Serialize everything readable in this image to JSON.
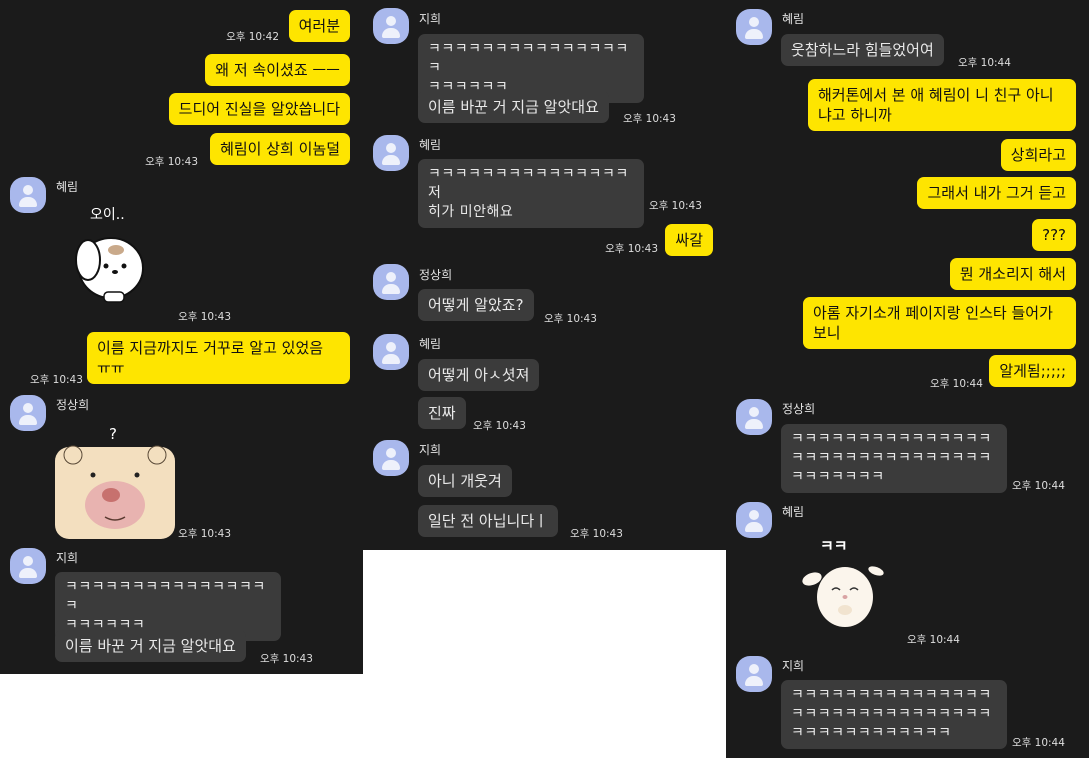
{
  "colors": {
    "background": "#1b1b1b",
    "my_bubble": "#fee500",
    "other_bubble": "#3b3b3b",
    "avatar": "#a9b8ec"
  },
  "icons": {
    "avatar": "default-profile-icon",
    "sticker1": "puppy-sticker",
    "sticker2": "bear-sticker",
    "sticker3": "bunny-sticker"
  },
  "panel1": {
    "m1": "여러분",
    "t1": "오후 10:42",
    "m2": "왜 저 속이셨죠 ㅡㅡ",
    "m3": "드디어 진실을 알았씁니다",
    "m4": "혜림이 상희 이놈덜",
    "t4": "오후 10:43",
    "name1": "혜림",
    "sticker1_text": "오이..",
    "t5": "오후 10:43",
    "m6": "이름 지금까지도 거꾸로 알고 있었음\nㅠㅠ",
    "t6": "오후 10:43",
    "name2": "정상희",
    "sticker2_text": "?",
    "t7": "오후 10:43",
    "name3": "지희",
    "m8": "ㅋㅋㅋㅋㅋㅋㅋㅋㅋㅋㅋㅋㅋㅋㅋㅋ\nㅋㅋㅋㅋㅋㅋ",
    "m9": "이름 바꾼 거 지금 알앗대요",
    "t9": "오후 10:43"
  },
  "panel2": {
    "name1": "지희",
    "m1": "ㅋㅋㅋㅋㅋㅋㅋㅋㅋㅋㅋㅋㅋㅋㅋㅋ\nㅋㅋㅋㅋㅋㅋ",
    "m2": "이름 바꾼 거 지금 알앗대요",
    "t2": "오후 10:43",
    "name2": "혜림",
    "m3": "ㅋㅋㅋㅋㅋㅋㅋㅋㅋㅋㅋㅋㅋㅋㅋ저\n히가 미안해요",
    "t3": "오후 10:43",
    "m4": "싸갈",
    "t4": "오후 10:43",
    "name3": "정상희",
    "m5": "어떻게 알았죠?",
    "t5": "오후 10:43",
    "name4": "혜림",
    "m6": "어떻게 아ㅅ셧져",
    "m7": "진짜",
    "t7": "오후 10:43",
    "name5": "지희",
    "m8": "아니 개웃겨",
    "m9": "일단 전 아닙니다ㅣ",
    "t9": "오후 10:43"
  },
  "panel3": {
    "name1": "혜림",
    "m1": "웃참하느라 힘들었어여",
    "t1": "오후 10:44",
    "m2": "해커톤에서 본 애 혜림이 니 친구 아니\n냐고 하니까",
    "m3": "상희라고",
    "m4": "그래서 내가 그거 듣고",
    "m5": "???",
    "m6": "뭔 개소리지 해서",
    "m7": "아롬 자기소개 페이지랑 인스타 들어가\n보니",
    "m8": "알게됨;;;;;",
    "t8": "오후 10:44",
    "name2": "정상희",
    "m9": "ㅋㅋㅋㅋㅋㅋㅋㅋㅋㅋㅋㅋㅋㅋㅋ\nㅋㅋㅋㅋㅋㅋㅋㅋㅋㅋㅋㅋㅋㅋㅋ\nㅋㅋㅋㅋㅋㅋㅋ",
    "t9": "오후 10:44",
    "name3": "혜림",
    "sticker3_text": "ㅋㅋ",
    "t10": "오후 10:44",
    "name4": "지희",
    "m11": "ㅋㅋㅋㅋㅋㅋㅋㅋㅋㅋㅋㅋㅋㅋㅋ\nㅋㅋㅋㅋㅋㅋㅋㅋㅋㅋㅋㅋㅋㅋㅋ\nㅋㅋㅋㅋㅋㅋㅋㅋㅋㅋㅋㅋ",
    "t11": "오후 10:44"
  }
}
